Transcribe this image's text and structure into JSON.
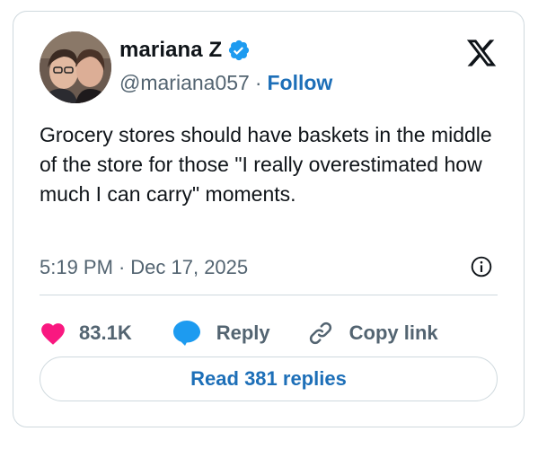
{
  "author": {
    "display_name": "mariana Z",
    "handle": "@mariana057",
    "follow_label": "Follow",
    "verified": true,
    "avatar_icon": "avatar-photo"
  },
  "tweet": {
    "text": "Grocery stores should have baskets in the middle of the store for those \"I really overestimated how much I can carry\" moments.",
    "time": "5:19 PM",
    "separator": "·",
    "date": "Dec 17, 2025"
  },
  "actions": {
    "like_count": "83.1K",
    "reply_label": "Reply",
    "copy_link_label": "Copy link",
    "read_replies_label": "Read 381 replies"
  },
  "colors": {
    "like": "#f91880",
    "reply_icon": "#1d9bf0",
    "link": "#1d6fb8",
    "secondary_text": "#536471",
    "border": "#cfd9de"
  },
  "icons": {
    "brand": "x-logo-icon",
    "verified": "verified-badge-icon",
    "info": "info-icon",
    "like": "heart-icon",
    "reply": "speech-bubble-icon",
    "copy_link": "link-icon"
  }
}
